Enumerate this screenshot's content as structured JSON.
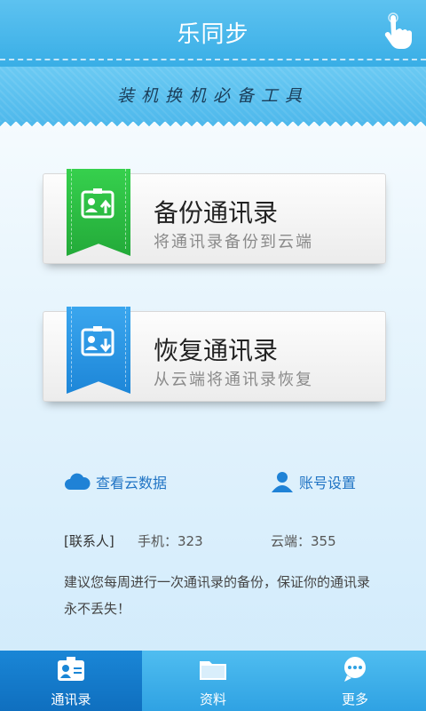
{
  "header": {
    "title": "乐同步",
    "hand_icon": "pointer-hand-icon"
  },
  "banner": {
    "slogan": "装机换机必备工具"
  },
  "backup_card": {
    "title": "备份通讯录",
    "subtitle": "将通讯录备份到云端",
    "icon": "contact-upload-icon",
    "color": "#2fbe45"
  },
  "restore_card": {
    "title": "恢复通讯录",
    "subtitle": "从云端将通讯录恢复",
    "icon": "contact-download-icon",
    "color": "#2b97e3"
  },
  "links": {
    "cloud_data": "查看云数据",
    "account_settings": "账号设置"
  },
  "stats": {
    "label": "[联系人]",
    "phone": "手机：323",
    "cloud": "云端：355"
  },
  "tip": "建议您每周进行一次通讯录的备份，保证你的通讯录永不丢失！",
  "tabs": [
    {
      "label": "通讯录",
      "icon": "contact-card-icon",
      "active": true
    },
    {
      "label": "资料",
      "icon": "folder-icon",
      "active": false
    },
    {
      "label": "更多",
      "icon": "chat-bubble-icon",
      "active": false
    }
  ]
}
